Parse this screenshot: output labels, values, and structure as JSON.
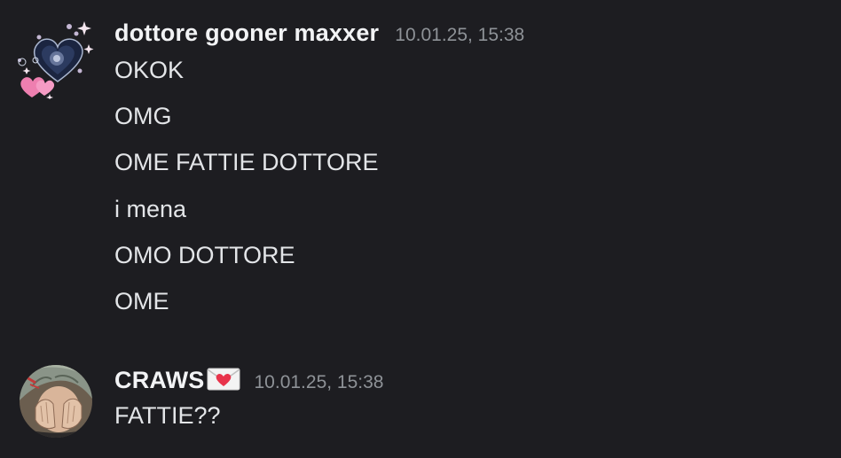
{
  "messages": [
    {
      "username": "dottore gooner maxxer",
      "timestamp": "10.01.25, 15:38",
      "avatar_icon": "sparkle-heart-avatar-icon",
      "lines": [
        "OKOK",
        "OMG",
        "OME FATTIE DOTTORE",
        "i mena",
        "OMO DOTTORE",
        "OME"
      ]
    },
    {
      "username": "CRAWS",
      "username_emoji": "love-letter-icon",
      "timestamp": "10.01.25, 15:38",
      "avatar_icon": "anime-character-avatar-icon",
      "lines": [
        "FATTIE??"
      ]
    }
  ],
  "colors": {
    "background": "#1d1d21",
    "username": "#f2f3f5",
    "timestamp": "#8e9297",
    "message_text": "#e3e5e8"
  }
}
